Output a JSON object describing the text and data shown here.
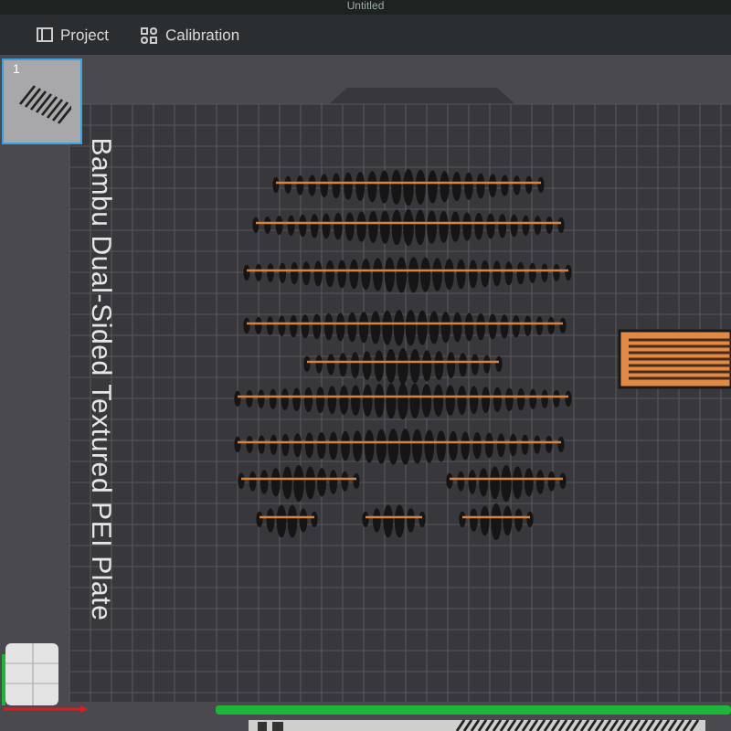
{
  "window": {
    "title": "Untitled"
  },
  "menu": [
    {
      "kind": "project",
      "label": "Project"
    },
    {
      "kind": "calibration",
      "label": "Calibration"
    }
  ],
  "plates": [
    {
      "label": "1",
      "selected": true
    }
  ],
  "bed": {
    "label": "Bambu Dual-Sided Textured PEI Plate"
  }
}
